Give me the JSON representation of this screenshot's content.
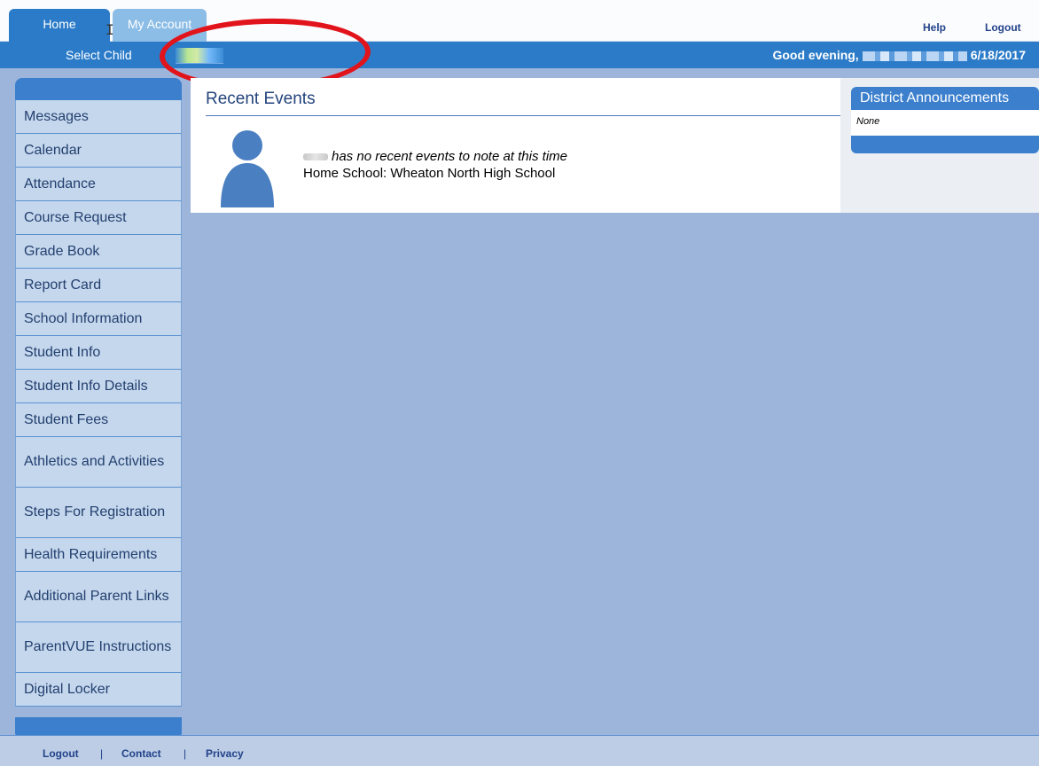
{
  "tabs": {
    "home": "Home",
    "my_account": "My Account"
  },
  "top_links": {
    "help": "Help",
    "logout": "Logout"
  },
  "header": {
    "select_child_label": "Select Child",
    "greeting_prefix": "Good evening,",
    "date": "6/18/2017"
  },
  "sidebar": {
    "items": [
      {
        "label": "Messages"
      },
      {
        "label": "Calendar"
      },
      {
        "label": "Attendance"
      },
      {
        "label": "Course Request"
      },
      {
        "label": "Grade Book"
      },
      {
        "label": "Report Card"
      },
      {
        "label": "School Information"
      },
      {
        "label": "Student Info"
      },
      {
        "label": "Student Info Details"
      },
      {
        "label": "Student Fees"
      },
      {
        "label": "Athletics and Activities"
      },
      {
        "label": "Steps For Registration"
      },
      {
        "label": "Health Requirements"
      },
      {
        "label": "Additional Parent Links"
      },
      {
        "label": "ParentVUE Instructions"
      },
      {
        "label": "Digital Locker"
      }
    ]
  },
  "main": {
    "heading": "Recent Events",
    "event_text": "has no recent events to note at this time",
    "home_school": "Home School: Wheaton North High School"
  },
  "announcements": {
    "title": "District Announcements",
    "body": "None"
  },
  "footer": {
    "logout": "Logout",
    "separator": "|",
    "contact": "Contact",
    "privacy": "Privacy"
  },
  "colors": {
    "primary_blue": "#2b7bc8",
    "page_background": "#9db5da",
    "annotation_red": "#e2141b"
  }
}
